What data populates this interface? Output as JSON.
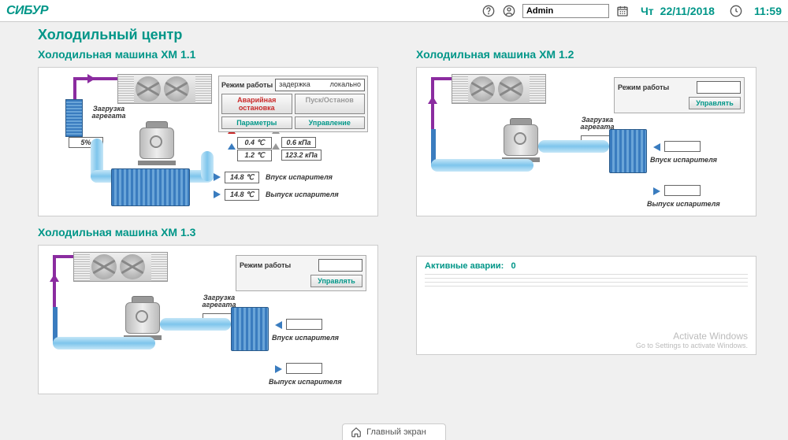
{
  "header": {
    "logo": "СИБУР",
    "user": "Admin",
    "day": "Чт",
    "date": "22/11/2018",
    "time": "11:59"
  },
  "page_title": "Холодильный центр",
  "machines": {
    "xm11": {
      "title": "Холодильная машина ХМ 1.1",
      "mode_label": "Режим работы",
      "mode_value1": "задержка",
      "mode_value2": "локально",
      "btn_emergency": "Аварийная остановка",
      "btn_startstop": "Пуск/Останов",
      "btn_params": "Параметры",
      "btn_control": "Управление",
      "load_label": "Загрузка агрегата",
      "load_value": "5%",
      "temp1": "0.4 ℃",
      "temp2": "1.2 ℃",
      "press1": "0.6 кПа",
      "press2": "123.2 кПа",
      "inlet_val": "14.8 ℃",
      "inlet_label": "Впуск испарителя",
      "outlet_val": "14.8 ℃",
      "outlet_label": "Выпуск испарителя"
    },
    "xm12": {
      "title": "Холодильная машина ХМ 1.2",
      "mode_label": "Режим работы",
      "btn_control": "Управлять",
      "load_label": "Загрузка агрегата",
      "inlet_label": "Впуск испарителя",
      "outlet_label": "Выпуск испарителя"
    },
    "xm13": {
      "title": "Холодильная машина ХМ 1.3",
      "mode_label": "Режим работы",
      "btn_control": "Управлять",
      "load_label": "Загрузка агрегата",
      "inlet_label": "Впуск испарителя",
      "outlet_label": "Выпуск испарителя"
    }
  },
  "alarms": {
    "title_prefix": "Активные аварии:",
    "count": "0"
  },
  "watermark": {
    "line1": "Activate Windows",
    "line2": "Go to Settings to activate Windows."
  },
  "bottom": {
    "home": "Главный экран"
  }
}
